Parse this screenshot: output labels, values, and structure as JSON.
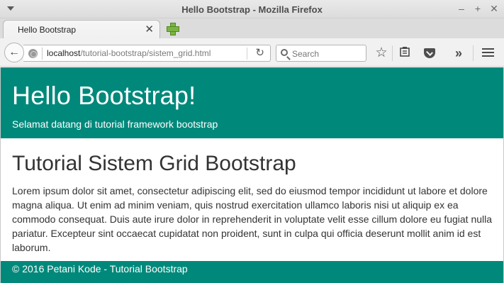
{
  "window": {
    "title": "Hello Bootstrap - Mozilla Firefox",
    "controls": {
      "minimize": "–",
      "maximize": "+",
      "close": "✕"
    }
  },
  "tabs": [
    {
      "label": "Hello Bootstrap",
      "close": "✕",
      "active": true
    }
  ],
  "navbar": {
    "back_glyph": "←",
    "url_host": "localhost",
    "url_path": "/tutorial-bootstrap/sistem_grid.html",
    "reload_glyph": "↻",
    "search_placeholder": "Search",
    "icons": [
      "bookmark-star-icon",
      "reading-list-icon",
      "pocket-icon",
      "overflow-icon",
      "menu-icon"
    ],
    "star_glyph": "☆",
    "overflow_glyph": "»"
  },
  "page": {
    "jumbotron": {
      "heading": "Hello Bootstrap!",
      "subtitle": "Selamat datang di tutorial framework bootstrap"
    },
    "section": {
      "heading": "Tutorial Sistem Grid Bootstrap",
      "body": "Lorem ipsum dolor sit amet, consectetur adipiscing elit, sed do eiusmod tempor incididunt ut labore et dolore magna aliqua. Ut enim ad minim veniam, quis nostrud exercitation ullamco laboris nisi ut aliquip ex ea commodo consequat. Duis aute irure dolor in reprehenderit in voluptate velit esse cillum dolore eu fugiat nulla pariatur. Excepteur sint occaecat cupidatat non proident, sunt in culpa qui officia deserunt mollit anim id est laborum."
    },
    "footer": {
      "text": "© 2016 Petani Kode - Tutorial Bootstrap"
    }
  },
  "colors": {
    "brand_teal": "#00897b",
    "text": "#333333",
    "chrome": "#f1f1f1"
  }
}
